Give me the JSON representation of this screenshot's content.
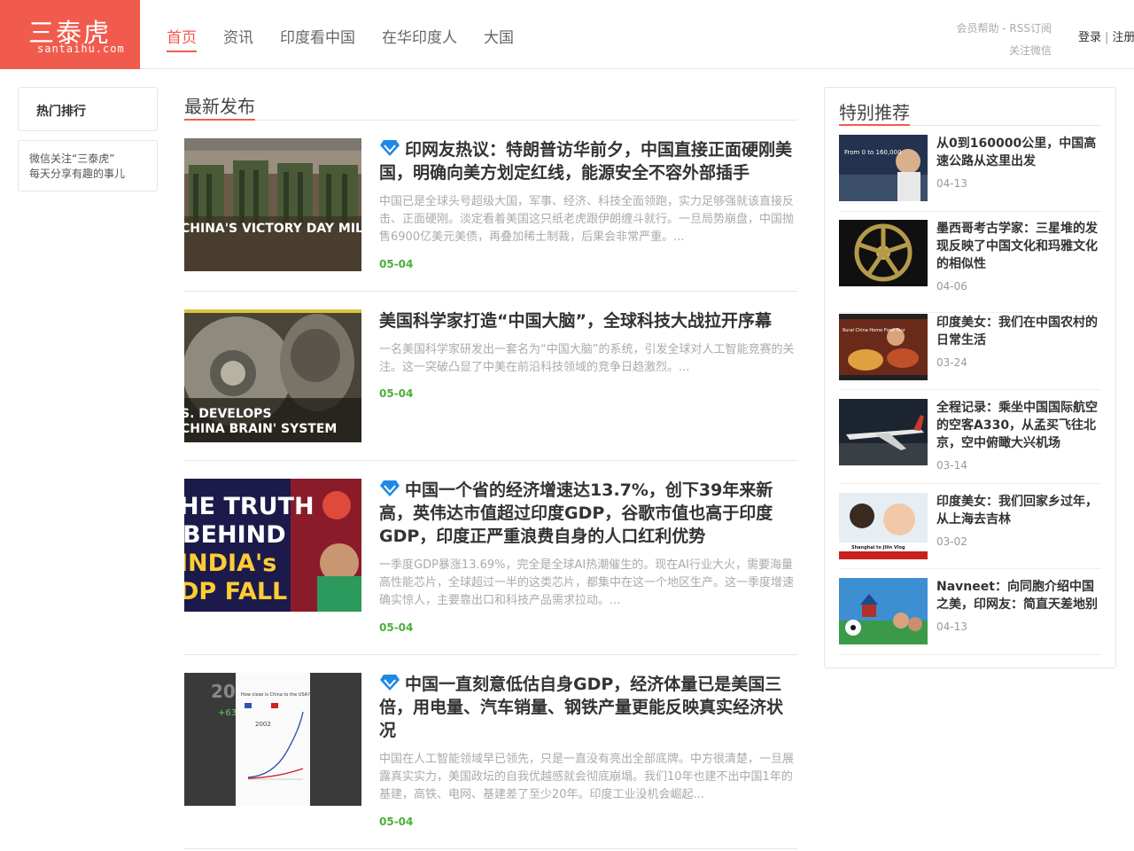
{
  "logo": {
    "cn": "三泰虎",
    "en": "santaihu.com"
  },
  "nav": [
    "首页",
    "资讯",
    "印度看中国",
    "在华印度人",
    "大国"
  ],
  "header_links": {
    "help": "会员帮助 - RSS订阅",
    "wechat": "关注微信",
    "login": "登录",
    "register": "注册"
  },
  "left": {
    "hot": "热门排行",
    "wechat_line1": "微信关注“三泰虎”",
    "wechat_line2": "每天分享有趣的事儿"
  },
  "main": {
    "section_title": "最新发布",
    "articles": [
      {
        "title": "印网友热议：特朗普访华前夕，中国直接正面硬刚美国，明确向美方划定红线，能源安全不容外部插手",
        "summary": "中国已是全球头号超级大国，军事、经济、科技全面领跑，实力足够强就该直接反击、正面硬刚。淡定看着美国这只纸老虎跟伊朗缠斗就行。一旦局势崩盘，中国抛售6900亿美元美债，再叠加稀土制裁，后果会非常严重。...",
        "date": "05-04",
        "thumb_text": "CHINA'S VICTORY DAY MILITARY PARADE"
      },
      {
        "title": "美国科学家打造“中国大脑”，全球科技大战拉开序幕",
        "summary": "一名美国科学家研发出一套名为“中国大脑”的系统，引发全球对人工智能竞赛的关注。这一突破凸显了中美在前沿科技领域的竞争日趋激烈。...",
        "date": "05-04",
        "thumb_text": "S. DEVELOPS CHINA BRAIN' SYSTEM"
      },
      {
        "title": "中国一个省的经济增速达13.7%，创下39年来新高，英伟达市值超过印度GDP，谷歌市值也高于印度GDP，印度正严重浪费自身的人口红利优势",
        "summary": "一季度GDP暴涨13.69%，完全是全球AI热潮催生的。现在AI行业大火，需要海量高性能芯片，全球超过一半的这类芯片，都集中在这一个地区生产。这一季度增速确实惊人，主要靠出口和科技产品需求拉动。...",
        "date": "05-04",
        "thumb_text": "HE TRUTH BEHIND INDIA'S DP FALL"
      },
      {
        "title": "中国一直刻意低估自身GDP，经济体量已是美国三倍，用电量、汽车销量、钢铁产量更能反映真实经济状况",
        "summary": "中国在人工智能领域早已领先，只是一直没有亮出全部底牌。中方很清楚，一旦展露真实实力，美国政坛的自我优越感就会彻底崩塌。我们10年也建不出中国1年的基建，高铁、电网、基建差了至少20年。印度工业没机会崛起...",
        "date": "05-04",
        "thumb_text": "How close is China to the USA?"
      }
    ]
  },
  "right": {
    "title": "特别推荐",
    "items": [
      {
        "title": "从0到160000公里，中国高速公路从这里出发",
        "date": "04-13",
        "thumb_text": "From 0 to 160,000"
      },
      {
        "title": "墨西哥考古学家：三星堆的发现反映了中国文化和玛雅文化的相似性",
        "date": "04-06",
        "thumb_text": ""
      },
      {
        "title": "印度美女：我们在中国农村的日常生活",
        "date": "03-24",
        "thumb_text": "Rural China Home Food Tour"
      },
      {
        "title": "全程记录：乘坐中国国际航空的空客A330，从孟买飞往北京，空中俯瞰大兴机场",
        "date": "03-14",
        "thumb_text": ""
      },
      {
        "title": "印度美女：我们回家乡过年，从上海去吉林",
        "date": "03-02",
        "thumb_text": "Shanghai to Jilin Vlog"
      },
      {
        "title": "Navneet：向同胞介绍中国之美，印网友：简直天差地别",
        "date": "04-13",
        "thumb_text": ""
      }
    ]
  }
}
